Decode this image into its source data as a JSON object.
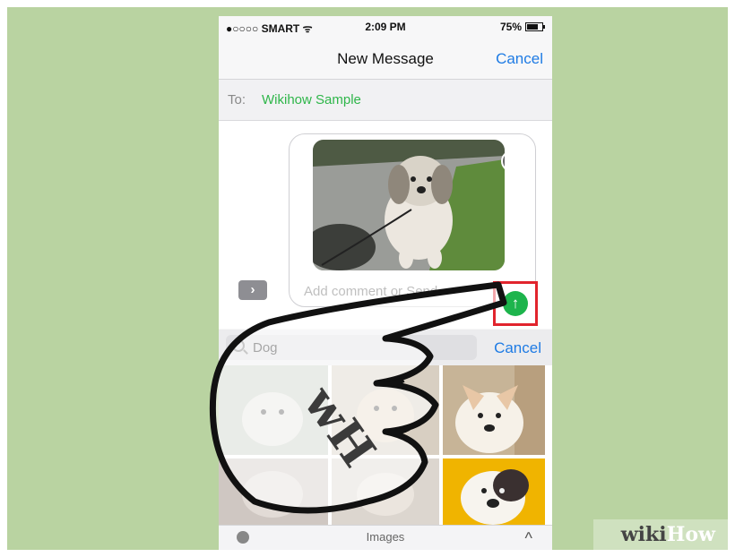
{
  "status_bar": {
    "carrier": "●○○○○ SMART ᯤ",
    "time": "2:09 PM",
    "battery": "75%"
  },
  "nav": {
    "title": "New Message",
    "cancel_label": "Cancel"
  },
  "to_field": {
    "label": "To:",
    "recipient": "Wikihow Sample"
  },
  "compose": {
    "placeholder": "Add comment or Send",
    "close_symbol": "✕",
    "expand_symbol": "›",
    "send_symbol": "↑"
  },
  "search": {
    "query": "Dog",
    "cancel_label": "Cancel"
  },
  "bottom_bar": {
    "label": "Images",
    "chevron": "^"
  },
  "watermark": {
    "wiki": "wiki",
    "how": "How"
  },
  "overlay": {
    "logo_text": "wH"
  },
  "colors": {
    "background": "#b9d3a1",
    "accent_blue": "#1e7be4",
    "recipient_green": "#2fb64a",
    "send_green": "#1db44c",
    "highlight_red": "#e1242d"
  },
  "icons": [
    "search-icon",
    "close-icon",
    "send-arrow-icon",
    "chevron-right-icon",
    "chevron-up-icon"
  ]
}
